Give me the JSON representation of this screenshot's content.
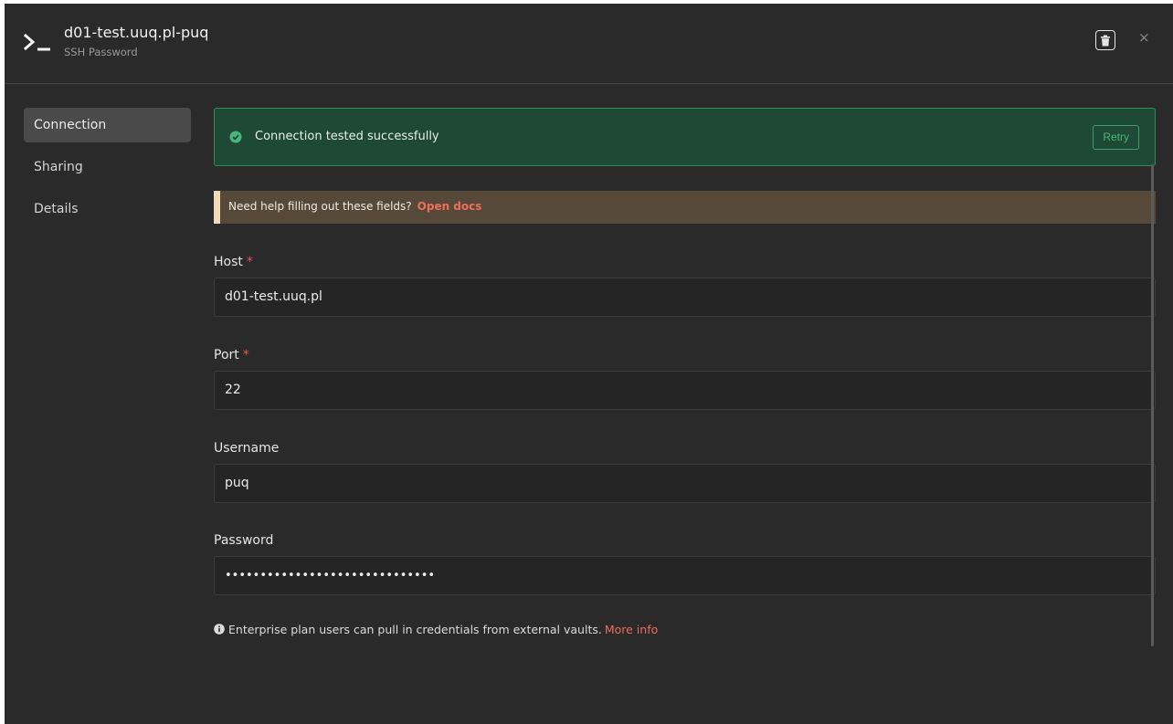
{
  "header": {
    "title": "d01-test.uuq.pl-puq",
    "subtitle": "SSH Password",
    "icon": "terminal-icon",
    "delete_icon": "trash-icon",
    "close_glyph": "×"
  },
  "sidebar": {
    "items": [
      {
        "label": "Connection",
        "active": true
      },
      {
        "label": "Sharing",
        "active": false
      },
      {
        "label": "Details",
        "active": false
      }
    ]
  },
  "success_banner": {
    "text": "Connection tested successfully",
    "retry_label": "Retry",
    "icon": "check-circle-icon"
  },
  "help_banner": {
    "text": "Need help filling out these fields?",
    "link": "Open docs"
  },
  "fields": {
    "host": {
      "label": "Host",
      "required": "*",
      "value": "d01-test.uuq.pl"
    },
    "port": {
      "label": "Port",
      "required": "*",
      "value": "22"
    },
    "username": {
      "label": "Username",
      "value": "puq"
    },
    "password": {
      "label": "Password",
      "value": "••••••••••••••••••••••••••••••"
    }
  },
  "info": {
    "icon": "info-icon",
    "text": "Enterprise plan users can pull in credentials from external vaults.",
    "link": "More info"
  },
  "colors": {
    "background": "#2a2a2a",
    "success_bg": "#1e4a35",
    "success_accent": "#49b57c",
    "link": "#ec6f5a",
    "required": "#e45a4a"
  }
}
